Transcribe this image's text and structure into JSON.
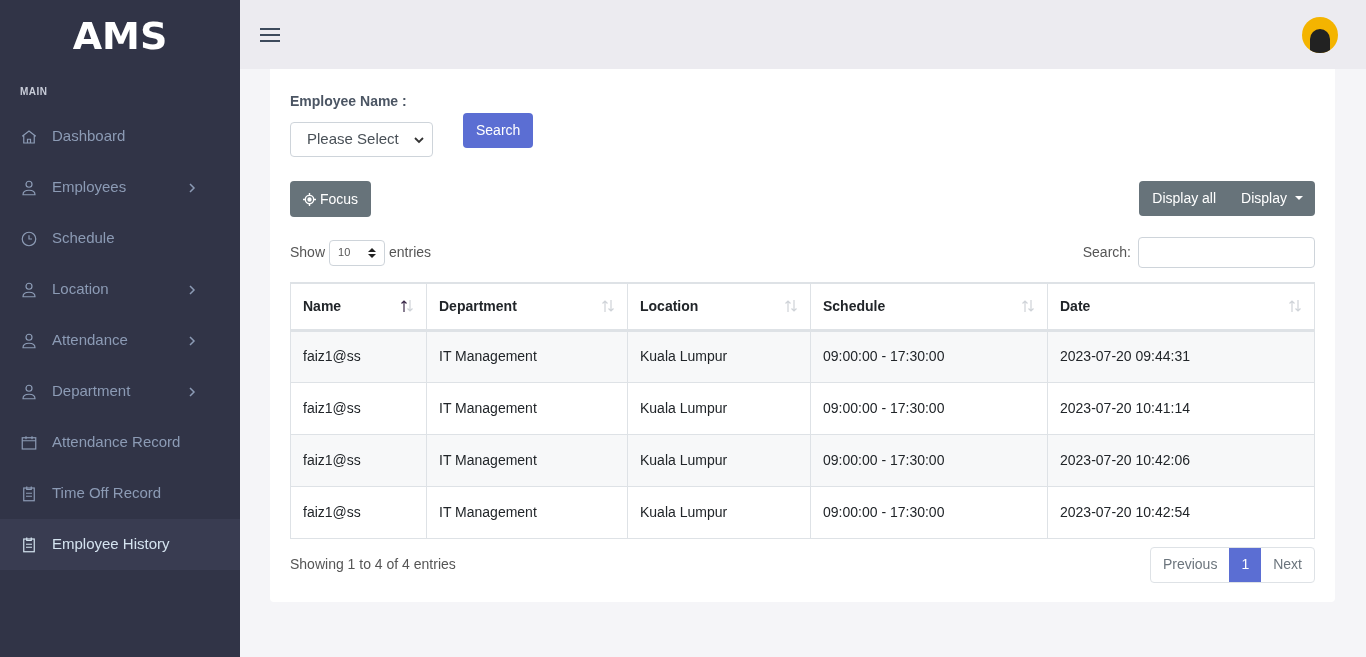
{
  "sidebar": {
    "logo": "AMS",
    "section": "MAIN",
    "items": [
      {
        "label": "Dashboard",
        "has_submenu": false,
        "selected": false
      },
      {
        "label": "Employees",
        "has_submenu": true,
        "selected": false
      },
      {
        "label": "Schedule",
        "has_submenu": false,
        "selected": false
      },
      {
        "label": "Location",
        "has_submenu": true,
        "selected": false
      },
      {
        "label": "Attendance",
        "has_submenu": true,
        "selected": false
      },
      {
        "label": "Department",
        "has_submenu": true,
        "selected": false
      },
      {
        "label": "Attendance Record",
        "has_submenu": false,
        "selected": false
      },
      {
        "label": "Time Off Record",
        "has_submenu": false,
        "selected": false
      },
      {
        "label": "Employee History",
        "has_submenu": false,
        "selected": true
      }
    ]
  },
  "filter": {
    "label": "Employee Name :",
    "select_value": "Please Select",
    "search_button": "Search"
  },
  "focus_button": "Focus",
  "display_all_button": "Display all",
  "display_button": "Display",
  "length": {
    "prefix": "Show",
    "value": "10",
    "suffix": "entries"
  },
  "table_search": {
    "label": "Search:"
  },
  "table": {
    "columns": [
      {
        "label": "Name",
        "sorted": true
      },
      {
        "label": "Department",
        "sorted": false
      },
      {
        "label": "Location",
        "sorted": false
      },
      {
        "label": "Schedule",
        "sorted": false
      },
      {
        "label": "Date",
        "sorted": false
      }
    ],
    "rows": [
      [
        "faiz1@ss",
        "IT Management",
        "Kuala Lumpur",
        "09:00:00 - 17:30:00",
        "2023-07-20 09:44:31"
      ],
      [
        "faiz1@ss",
        "IT Management",
        "Kuala Lumpur",
        "09:00:00 - 17:30:00",
        "2023-07-20 10:41:14"
      ],
      [
        "faiz1@ss",
        "IT Management",
        "Kuala Lumpur",
        "09:00:00 - 17:30:00",
        "2023-07-20 10:42:06"
      ],
      [
        "faiz1@ss",
        "IT Management",
        "Kuala Lumpur",
        "09:00:00 - 17:30:00",
        "2023-07-20 10:42:54"
      ]
    ]
  },
  "info": "Showing 1 to 4 of 4 entries",
  "pagination": [
    {
      "label": "Previous",
      "selected": false
    },
    {
      "label": "1",
      "selected": true
    },
    {
      "label": "Next",
      "selected": false
    }
  ]
}
